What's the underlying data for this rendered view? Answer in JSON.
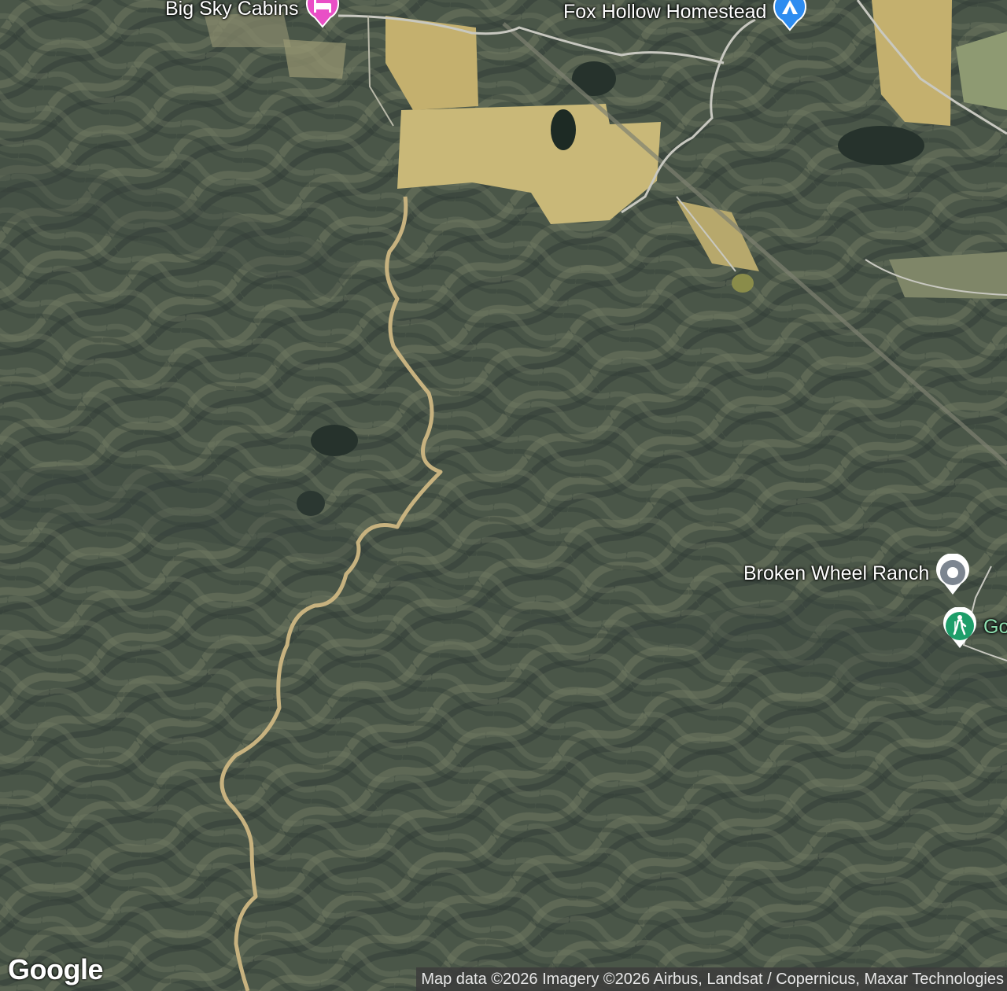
{
  "map": {
    "type": "satellite",
    "colors": {
      "forest_dark": "#3d4a42",
      "forest_mid": "#55624f",
      "ridge_light": "#7a8068",
      "field": "#c9b878",
      "creek": "#c7b27f",
      "road": "#c8c8c0",
      "pond": "#1d2a24"
    }
  },
  "places": [
    {
      "id": "big-sky-cabins",
      "label": "Big Sky Cabins",
      "category": "lodging",
      "icon": "bed-icon",
      "color": "#e94fc6"
    },
    {
      "id": "fox-hollow-homestead",
      "label": "Fox Hollow Homestead",
      "category": "camping",
      "icon": "tent-icon",
      "color": "#2d8cf0"
    },
    {
      "id": "broken-wheel-ranch",
      "label": "Broken Wheel Ranch",
      "category": "place",
      "icon": "dot-icon",
      "color": "#7c8590"
    },
    {
      "id": "trail",
      "label": "Go",
      "category": "hiking",
      "icon": "hiker-icon",
      "color": "#1e9e6a"
    }
  ],
  "branding": {
    "logo": "Google"
  },
  "attribution": "Map data ©2026 Imagery ©2026 Airbus, Landsat / Copernicus, Maxar Technologies"
}
